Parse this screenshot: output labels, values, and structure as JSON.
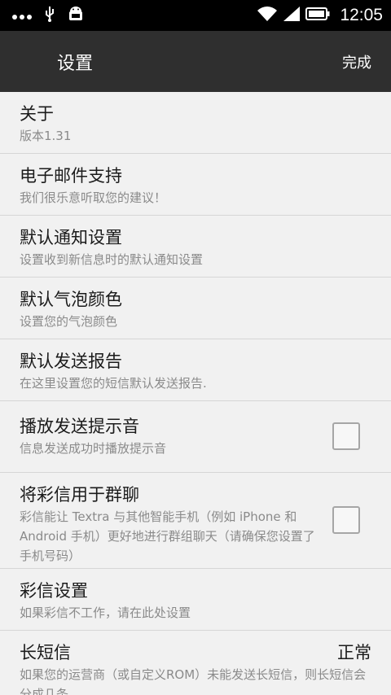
{
  "status_bar": {
    "time": "12:05",
    "icons": [
      "more-icon",
      "usb-icon",
      "android-icon",
      "wifi-icon",
      "signal-icon",
      "battery-icon"
    ]
  },
  "app_bar": {
    "title": "设置",
    "action": "完成"
  },
  "items": [
    {
      "title": "关于",
      "subtitle": "版本1.31"
    },
    {
      "title": "电子邮件支持",
      "subtitle": "我们很乐意听取您的建议！"
    },
    {
      "title": "默认通知设置",
      "subtitle": "设置收到新信息时的默认通知设置"
    },
    {
      "title": "默认气泡颜色",
      "subtitle": "设置您的气泡颜色"
    },
    {
      "title": "默认发送报告",
      "subtitle": "在这里设置您的短信默认发送报告."
    },
    {
      "title": "播放发送提示音",
      "subtitle": "信息发送成功时播放提示音",
      "checked": false
    },
    {
      "title": "将彩信用于群聊",
      "subtitle": "彩信能让 Textra 与其他智能手机（例如 iPhone 和 Android 手机）更好地进行群组聊天（请确保您设置了手机号码）",
      "checked": false
    },
    {
      "title": "彩信设置",
      "subtitle": "如果彩信不工作，请在此处设置"
    },
    {
      "title": "长短信",
      "value": "正常",
      "subtitle": "如果您的运营商（或自定义ROM）未能发送长短信，则长短信会分成几条"
    }
  ]
}
